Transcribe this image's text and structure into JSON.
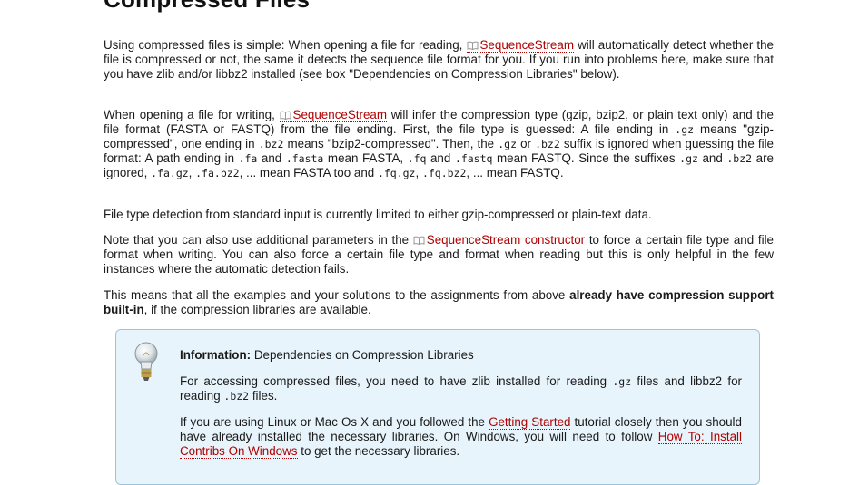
{
  "heading": "Compressed Files",
  "class_link": "SequenceStream",
  "para1": {
    "a": "Using compressed files is simple: When opening a file for reading, ",
    "b": " will automatically detect whether the file is compressed or not, the same it detects the sequence file format for you. If you run into problems here, make sure that you have zlib and/or libbz2 installed (see box \"Dependencies on Compression Libraries\" below)."
  },
  "para2": {
    "t1": "When opening a file for writing, ",
    "t2": " will infer the compression type (gzip, bzip2, or plain text only) and the file format (FASTA or FASTQ) from the file ending. First, the file type is guessed: A file ending in ",
    "c1": ".gz",
    "t3": " means \"gzip-compressed\", one ending in ",
    "c2": ".bz2",
    "t4": " means \"bzip2-compressed\". Then, the ",
    "c3": ".gz",
    "t5": " or ",
    "c4": ".bz2",
    "t6": " suffix is ignored when guessing the file format: A path ending in ",
    "c5": ".fa",
    "t7": " and ",
    "c6": ".fasta",
    "t8": " mean FASTA, ",
    "c7": ".fq",
    "t9": " and ",
    "c8": ".fastq",
    "t10": " mean FASTQ. Since the suffixes ",
    "c9": ".gz",
    "t11": " and ",
    "c10": ".bz2",
    "t12": " are ignored, ",
    "c11": ".fa.gz",
    "t13": ", ",
    "c12": ".fa.bz2",
    "t14": ", ... mean FASTA too and ",
    "c13": ".fq.gz",
    "t15": ", ",
    "c14": ".fq.bz2",
    "t16": ", ... mean FASTQ."
  },
  "para3": "File type detection from standard input is currently limited to either gzip-compressed or plain-text data.",
  "para4": {
    "a": "Note that you can also use additional parameters in the ",
    "link": "SequenceStream constructor",
    "b": " to force a certain file type and file format when writing. You can also force a certain file type and format when reading but this is only helpful in the few instances where the automatic detection fails."
  },
  "para5": {
    "a": "This means that all the examples and your solutions to the assignments from above ",
    "bold": "already have compression support built-in",
    "b": ", if the compression libraries are available."
  },
  "infobox": {
    "label": "Information:",
    "title": " Dependencies on Compression Libraries",
    "p1a": "For accessing compressed files, you need to have zlib installed for reading ",
    "p1c1": ".gz",
    "p1b": " files and libbz2 for reading ",
    "p1c2": ".bz2",
    "p1d": " files.",
    "p2a": "If you are using Linux or Mac Os X and you followed the ",
    "p2link1": "Getting Started",
    "p2b": " tutorial closely then you should have already installed the necessary libraries. On Windows, you will need to follow ",
    "p2link2": "How To: Install Contribs On Windows",
    "p2c": " to get the necessary libraries."
  }
}
